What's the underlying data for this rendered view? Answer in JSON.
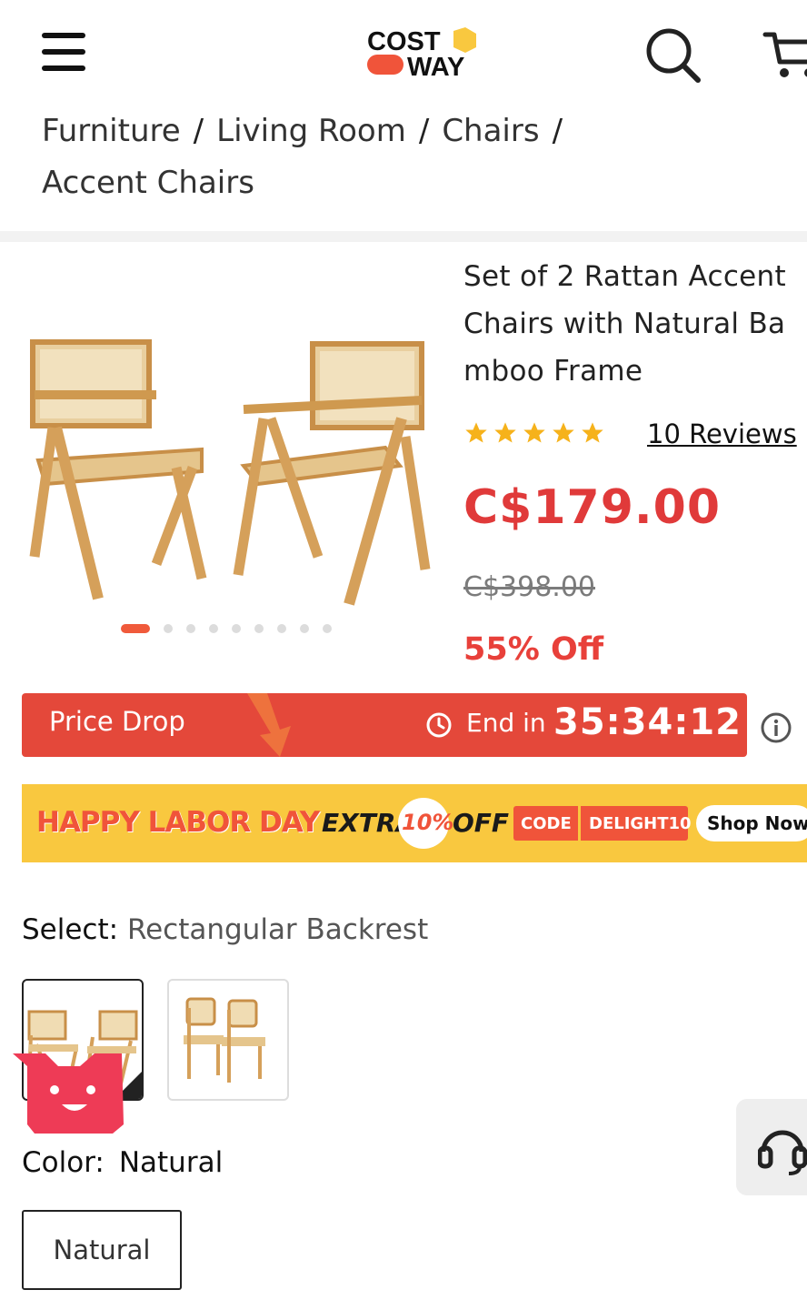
{
  "header": {
    "logo": {
      "line1": "COST",
      "line2": "WAY"
    },
    "menu_icon": "hamburger-icon",
    "search_icon": "search-icon",
    "cart_icon": "cart-icon"
  },
  "breadcrumb": {
    "items": [
      "Furniture",
      "Living Room",
      "Chairs",
      "Accent Chairs"
    ],
    "separator": "/"
  },
  "product": {
    "title": "Set of 2 Rattan Accent Chairs with Natural Bamboo Frame",
    "rating": 5,
    "reviews": "10 Reviews",
    "price": "C$179.00",
    "original_price": "C$398.00",
    "discount": "55% Off",
    "image_count": 10,
    "active_image": 1
  },
  "price_drop": {
    "label": "Price Drop",
    "end_in": "End in",
    "timer": "35:34:12"
  },
  "promo": {
    "headline": "HAPPY LABOR DAY",
    "extra": "EXTRA",
    "percent": "10%",
    "off": "OFF",
    "code_label": "CODE",
    "code": "DELIGHT10",
    "cta": "Shop Now"
  },
  "select": {
    "label": "Select:",
    "value": "Rectangular Backrest"
  },
  "color": {
    "label": "Color:",
    "value": "Natural",
    "option": "Natural"
  },
  "colors": {
    "accent": "#e03a3a",
    "price_drop_bg": "#e4483a",
    "promo_bg": "#f9c83f",
    "promo_red": "#f0543a",
    "wood": "#d9a560"
  }
}
